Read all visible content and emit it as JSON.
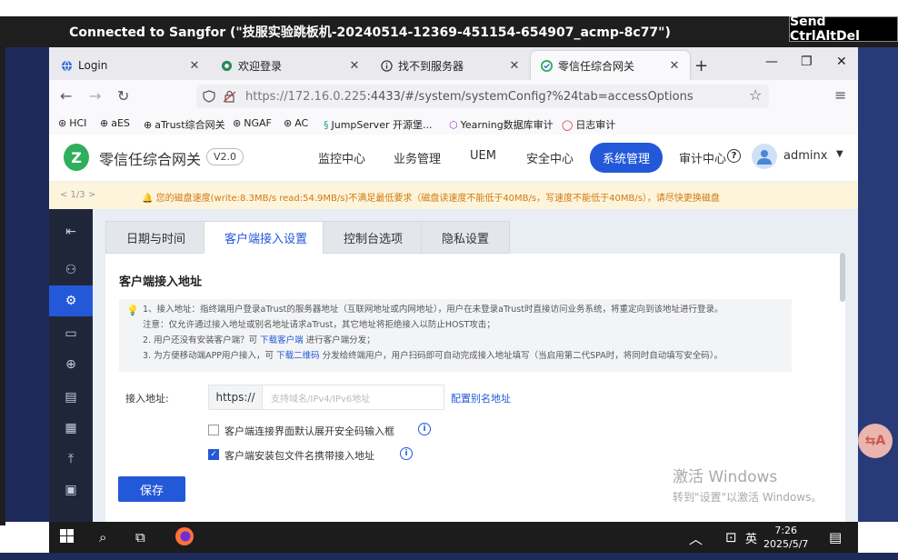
{
  "remote": {
    "title": "Connected to Sangfor (\"技服实验跳板机-20240514-12369-451154-654907_acmp-8c77\")",
    "send_ctrl_alt_del": "Send CtrlAltDel"
  },
  "browser": {
    "tabs": [
      {
        "label": "Login",
        "icon": "globe-icon"
      },
      {
        "label": "欢迎登录",
        "icon": "browser-icon"
      },
      {
        "label": "找不到服务器",
        "icon": "info-icon"
      },
      {
        "label": "零信任综合网关",
        "icon": "shield-icon"
      }
    ],
    "new_tab": "+",
    "url_host": "https://172.16.0.225",
    "url_rest": ":4433/#/system/systemConfig?%24tab=accessOptions",
    "bookmarks": [
      "HCI",
      "aES",
      "aTrust综合网关",
      "NGAF",
      "AC",
      "JumpServer 开源堡...",
      "Yearning数据库审计",
      "日志审计"
    ]
  },
  "app": {
    "name": "零信任综合网关",
    "version": "V2.0",
    "nav": [
      "监控中心",
      "业务管理",
      "UEM",
      "安全中心",
      "系统管理",
      "审计中心"
    ],
    "active_nav": "系统管理",
    "user": "adminx",
    "notice": {
      "page": "< 1/3 >",
      "message": "您的磁盘速度(write:8.3MB/s read:54.9MB/s)不满足最低要求（磁盘读速度不能低于40MB/s，写速度不能低于40MB/s），请尽快更换磁盘"
    }
  },
  "content": {
    "tabs": [
      "日期与时间",
      "客户端接入设置",
      "控制台选项",
      "隐私设置"
    ],
    "active_tab": "客户端接入设置",
    "section_title": "客户端接入地址",
    "tips": {
      "line1": "1、接入地址：指终端用户登录aTrust的服务器地址（互联网地址或内网地址），用户在未登录aTrust时直接访问业务系统，将重定向到该地址进行登录。",
      "line2": "注意：仅允许通过接入地址或别名地址请求aTrust，其它地址将拒绝接入以防止HOST攻击；",
      "line3_pre": "2. 用户还没有安装客户端？可",
      "line3_link": "下载客户端",
      "line3_post": "进行客户端分发；",
      "line4_pre": "3. 为方便移动端APP用户接入，可",
      "line4_link": "下载二维码",
      "line4_post": "分发给终端用户，用户扫码即可自动完成接入地址填写（当启用第二代SPA时，将同时自动填写安全码）。"
    },
    "access_label": "接入地址:",
    "protocol_prefix": "https://",
    "address_placeholder": "支持域名/IPv4/IPv6地址",
    "alias_link": "配置别名地址",
    "checkbox1_label": "客户端连接界面默认展开安全码输入框",
    "checkbox1_checked": false,
    "checkbox2_label": "客户端安装包文件名携带接入地址",
    "checkbox2_checked": true,
    "save_label": "保存"
  },
  "watermark": {
    "line1": "激活 Windows",
    "line2": "转到\"设置\"以激活 Windows。"
  },
  "floating_button": "⇆A",
  "taskbar": {
    "ime": "英",
    "time": "7:26",
    "date": "2025/5/7"
  }
}
